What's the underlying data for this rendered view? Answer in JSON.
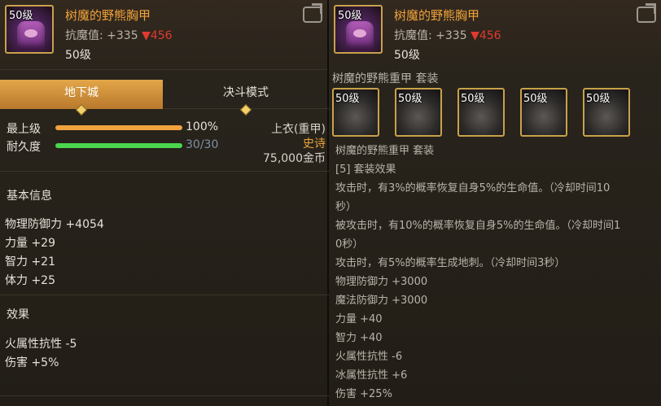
{
  "left": {
    "item": {
      "level_badge": "50级",
      "name": "树魔的野熊胸甲",
      "magic_res_label": "抗魔值: +335",
      "magic_res_drop": "▼456",
      "req_level": "50级"
    },
    "tabs": [
      {
        "label": "地下城"
      },
      {
        "label": "决斗模式"
      }
    ],
    "bars": [
      {
        "label": "最上级",
        "value": "100%",
        "fraction": 1.0,
        "color": "#f1a23f"
      },
      {
        "label": "耐久度",
        "value": "30/30",
        "fraction": 1.0,
        "color": "#4bd64f"
      }
    ],
    "slot": {
      "type": "上衣(重甲)",
      "rarity": "史诗",
      "price": "75,000金币"
    },
    "basic_info": {
      "title": "基本信息",
      "stats": [
        "物理防御力 +4054",
        "力量 +29",
        "智力 +21",
        "体力 +25"
      ]
    },
    "effects": {
      "title": "效果",
      "stats": [
        "火属性抗性 -5",
        "伤害 +5%"
      ]
    }
  },
  "right": {
    "item": {
      "level_badge": "50级",
      "name": "树魔的野熊胸甲",
      "magic_res_label": "抗魔值: +335",
      "magic_res_drop": "▼456",
      "req_level": "50级"
    },
    "set": {
      "title": "树魔的野熊重甲 套装",
      "icons": [
        {
          "level_badge": "50级"
        },
        {
          "level_badge": "50级"
        },
        {
          "level_badge": "50级"
        },
        {
          "level_badge": "50级"
        },
        {
          "level_badge": "50级"
        }
      ],
      "lines": [
        "树魔的野熊重甲 套装",
        "[5] 套装效果",
        "攻击时，有3%的概率恢复自身5%的生命值。（冷却时间10",
        "秒）",
        "被攻击时，有10%的概率恢复自身5%的生命值。（冷却时间1",
        "0秒）",
        "攻击时，有5%的概率生成地刺。（冷却时间3秒）",
        "物理防御力 +3000",
        "魔法防御力 +3000",
        "力量 +40",
        "智力 +40",
        "火属性抗性 -6",
        "冰属性抗性 +6",
        "伤害 +25%"
      ]
    }
  },
  "colors": {
    "accent": "#f0a23a",
    "down": "#e03a2e",
    "epic": "#e8a33a",
    "gold_border": "#c9a14a"
  }
}
